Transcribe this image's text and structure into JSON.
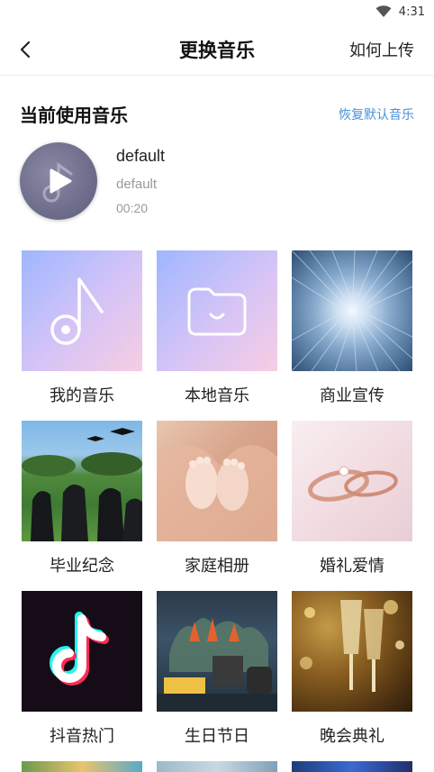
{
  "status_bar": {
    "time": "4:31"
  },
  "nav": {
    "title": "更换音乐",
    "help_label": "如何上传"
  },
  "current_section": {
    "label": "当前使用音乐",
    "restore_label": "恢复默认音乐",
    "track": {
      "name": "default",
      "artist": "default",
      "duration": "00:20"
    }
  },
  "categories": [
    {
      "label": "我的音乐"
    },
    {
      "label": "本地音乐"
    },
    {
      "label": "商业宣传"
    },
    {
      "label": "毕业纪念"
    },
    {
      "label": "家庭相册"
    },
    {
      "label": "婚礼爱情"
    },
    {
      "label": "抖音热门"
    },
    {
      "label": "生日节日"
    },
    {
      "label": "晚会典礼"
    }
  ],
  "colors": {
    "accent_link": "#4a90d9",
    "text_primary": "#222222",
    "text_secondary": "#999999"
  }
}
